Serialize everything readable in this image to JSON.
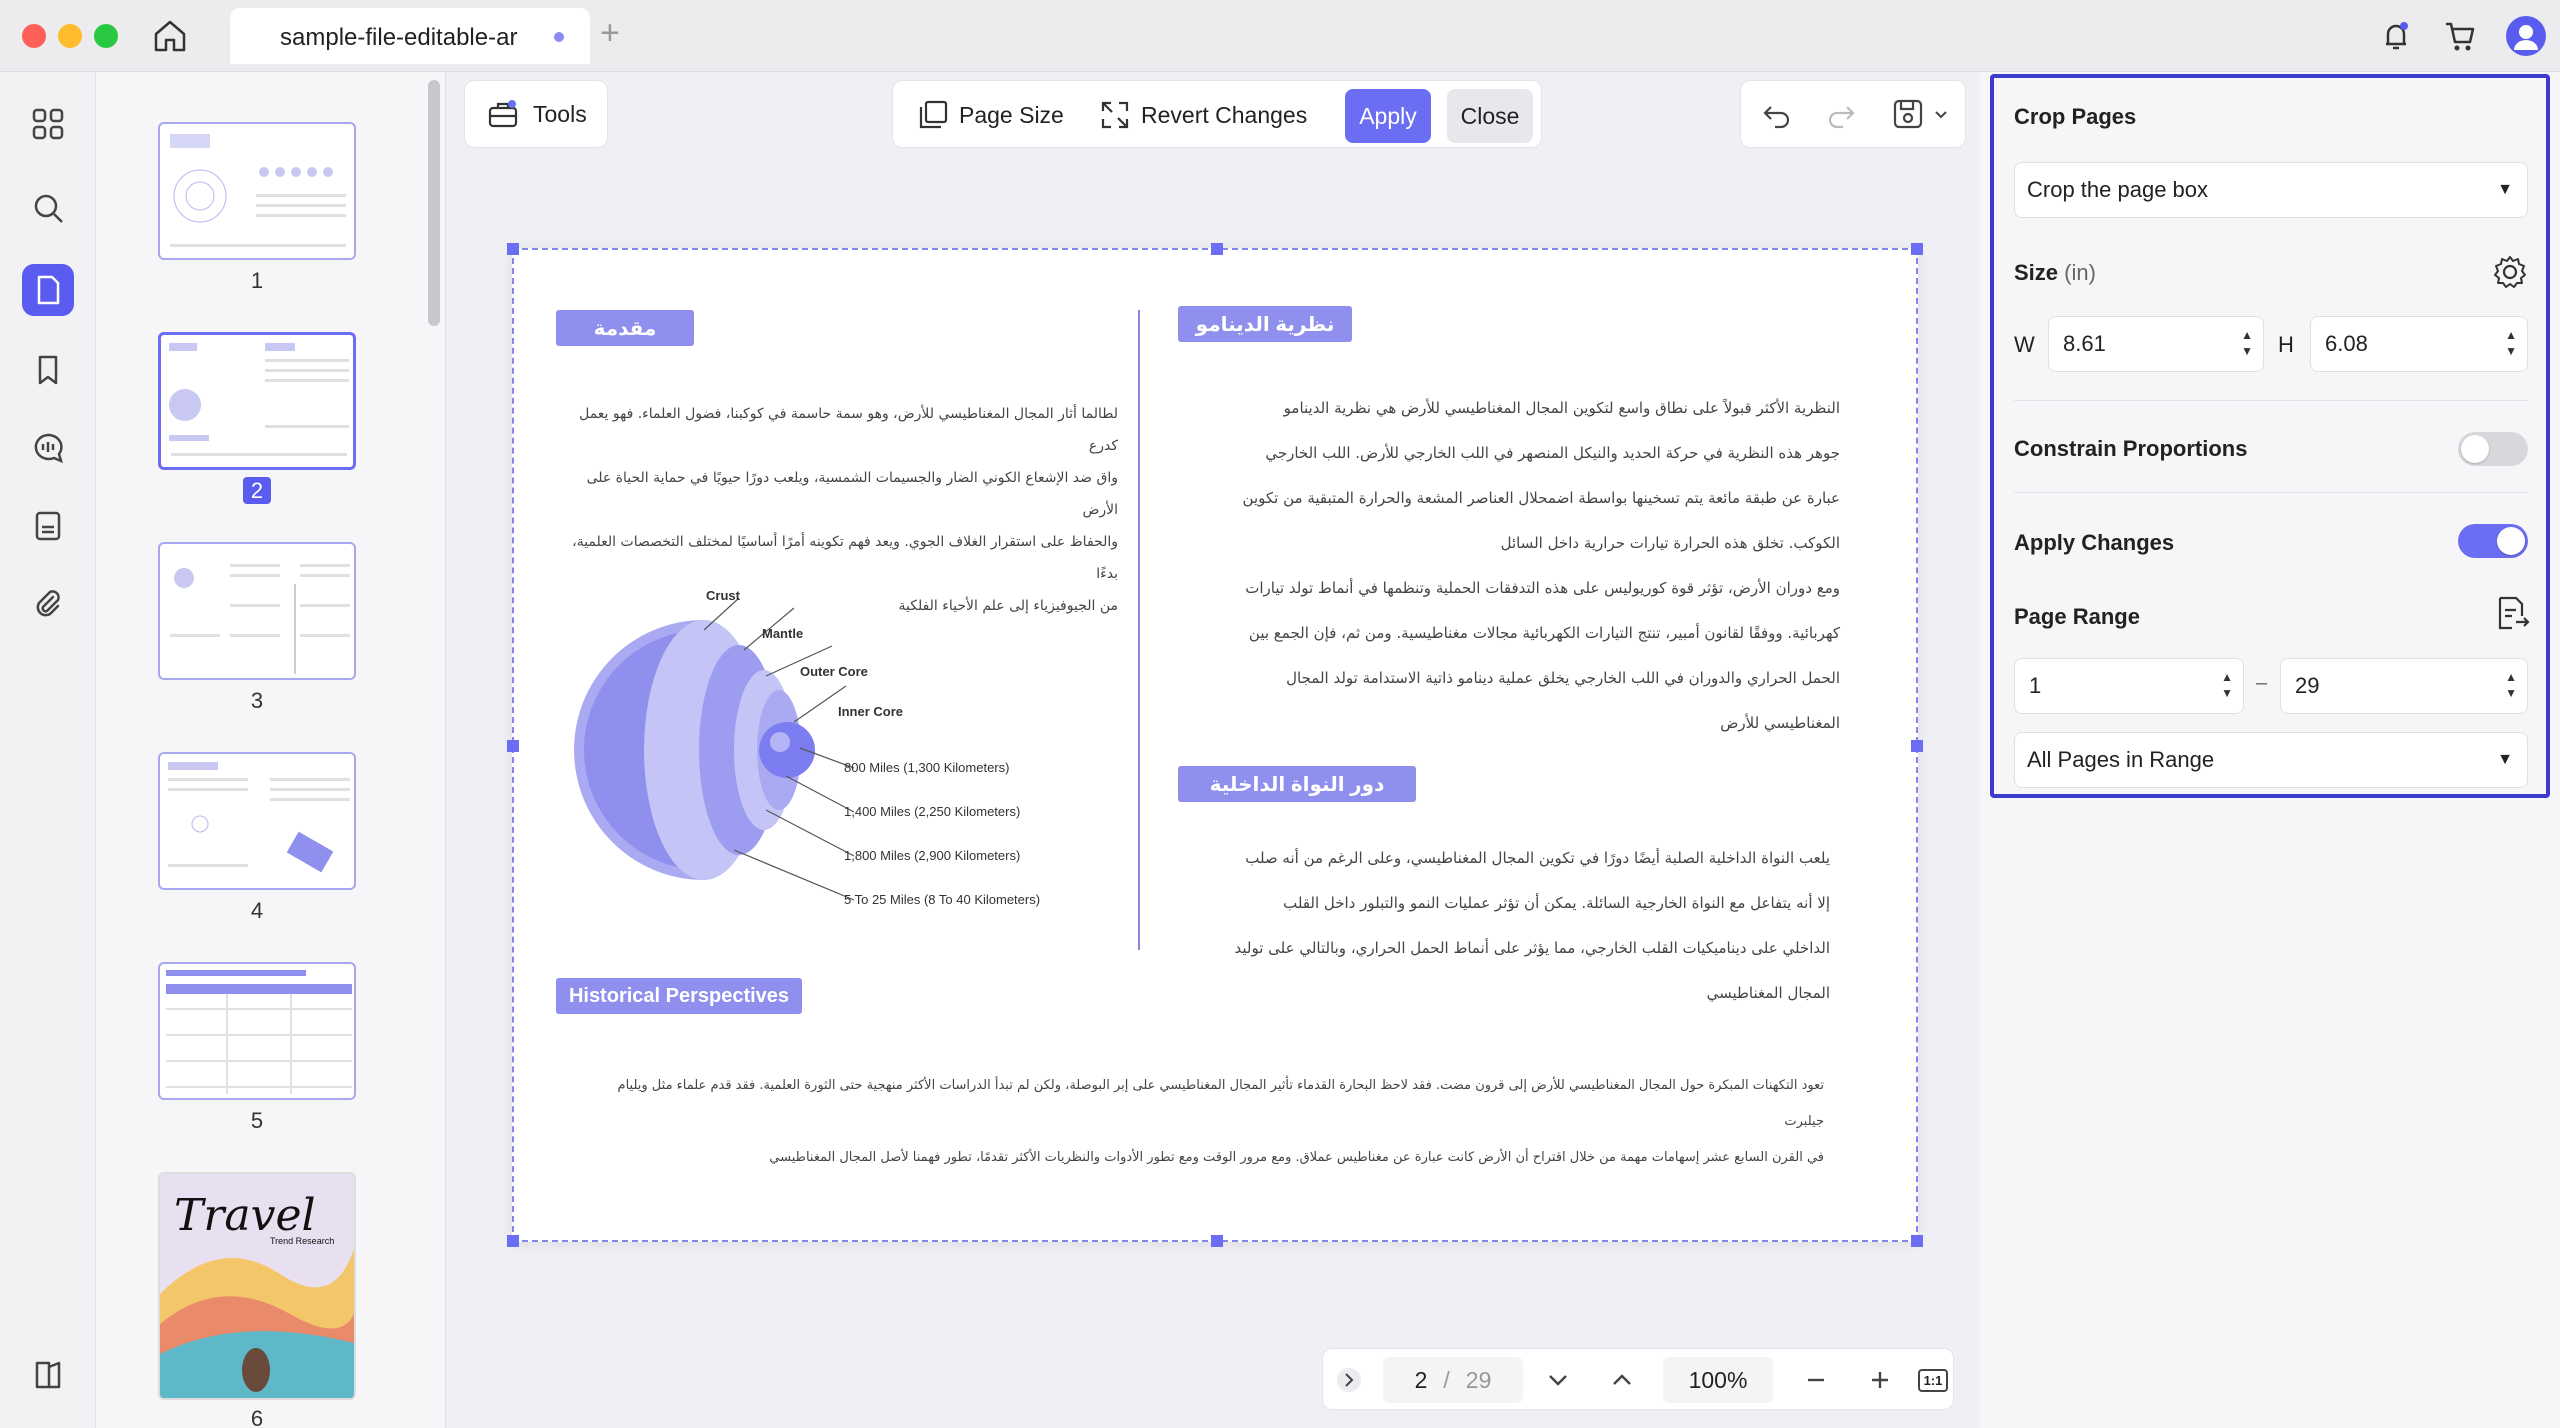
{
  "window": {
    "tab_title": "sample-file-editable-ar",
    "tab_plus": "+"
  },
  "thumbnails": {
    "pages": [
      "1",
      "2",
      "3",
      "4",
      "5",
      "6"
    ],
    "active": "2",
    "travel_text": "Travel",
    "travel_sub": "Trend Research"
  },
  "toolbar": {
    "tools_label": "Tools",
    "page_size_label": "Page Size",
    "revert_label": "Revert Changes",
    "apply_label": "Apply",
    "close_label": "Close"
  },
  "document": {
    "intro_title": "مقدمة",
    "intro_lines": [
      "لطالما أثار المجال المغناطيسي للأرض، وهو سمة حاسمة في كوكبنا، فضول العلماء. فهو يعمل كدرع",
      "واق ضد الإشعاع الكوني الضار والجسيمات الشمسية، ويلعب دورًا حيويًا في حماية الحياة على الأرض",
      "والحفاظ على استقرار الغلاف الجوي. ويعد فهم تكوينه أمرًا أساسيًا لمختلف التخصصات العلمية، بدءًا",
      "من الجيوفيزياء إلى علم الأحياء الفلكية"
    ],
    "dynamo_title": "نظرية الدينامو",
    "dynamo_lines": [
      "النظرية الأكثر قبولاً على نطاق واسع لتكوين المجال المغناطيسي للأرض هي نظرية الدينامو",
      "جوهر هذه النظرية في حركة الحديد والنيكل المنصهر في اللب الخارجي للأرض. اللب الخارجي",
      "عبارة عن طبقة مائعة يتم تسخينها بواسطة اضمحلال العناصر المشعة والحرارة المتبقية من تكوين",
      "الكوكب. تخلق هذه الحرارة تيارات حرارية داخل السائل",
      "ومع دوران الأرض، تؤثر قوة كوريوليس على هذه التدفقات الحملية وتنظمها في أنماط تولد تيارات",
      "كهربائية. ووفقًا لقانون أمبير، تنتج التيارات الكهربائية مجالات مغناطيسية. ومن ثم، فإن الجمع بين",
      "الحمل الحراري والدوران في اللب الخارجي يخلق عملية دينامو ذاتية الاستدامة تولد المجال",
      "المغناطيسي للأرض"
    ],
    "core_title": "دور النواة الداخلية",
    "core_lines": [
      "يلعب النواة الداخلية الصلبة أيضًا دورًا في تكوين المجال المغناطيسي، وعلى الرغم من أنه صلب",
      "إلا أنه يتفاعل مع النواة الخارجية السائلة. يمكن أن تؤثر عمليات النمو والتبلور داخل القلب",
      "الداخلي على ديناميكيات القلب الخارجي، مما يؤثر على أنماط الحمل الحراري، وبالتالي على توليد",
      "المجال المغناطيسي"
    ],
    "history_title": "Historical Perspectives",
    "history_lines": [
      "تعود التكهنات المبكرة حول المجال المغناطيسي للأرض إلى قرون مضت. فقد لاحظ البحارة القدماء تأثير المجال المغناطيسي على إبر البوصلة، ولكن لم تبدأ الدراسات الأكثر منهجية حتى الثورة العلمية. فقد قدم علماء مثل ويليام جيلبرت",
      "في القرن السابع عشر إسهامات مهمة من خلال اقتراح أن الأرض كانت عبارة عن مغناطيس عملاق. ومع مرور الوقت ومع تطور الأدوات والنظريات الأكثر تقدمًا، تطور فهمنا لأصل المجال المغناطيسي"
    ],
    "diagram": {
      "crust": "Crust",
      "mantle": "Mantle",
      "outer_core": "Outer Core",
      "inner_core": "Inner Core",
      "d1": "800 Miles (1,300 Kilometers)",
      "d2": "1,400 Miles (2,250 Kilometers)",
      "d3": "1,800 Miles (2,900 Kilometers)",
      "d4": "5 To 25 Miles (8 To 40 Kilometers)"
    }
  },
  "bottom_nav": {
    "page": "2",
    "separator": "/",
    "total": "29",
    "zoom": "100%",
    "fit_label": "1:1"
  },
  "crop_panel": {
    "title": "Crop Pages",
    "mode": "Crop the page box",
    "size_label": "Size",
    "size_unit": "(in)",
    "w_label": "W",
    "w_value": "8.61",
    "h_label": "H",
    "h_value": "6.08",
    "constrain_label": "Constrain Proportions",
    "constrain_on": false,
    "apply_changes_label": "Apply Changes",
    "apply_changes_on": true,
    "page_range_label": "Page Range",
    "range_from": "1",
    "range_dash": "–",
    "range_to": "29",
    "range_mode": "All Pages in Range"
  },
  "colors": {
    "accent": "#6b6df2",
    "panel_border": "#3c3cc8",
    "badge": "#8f90ee"
  }
}
